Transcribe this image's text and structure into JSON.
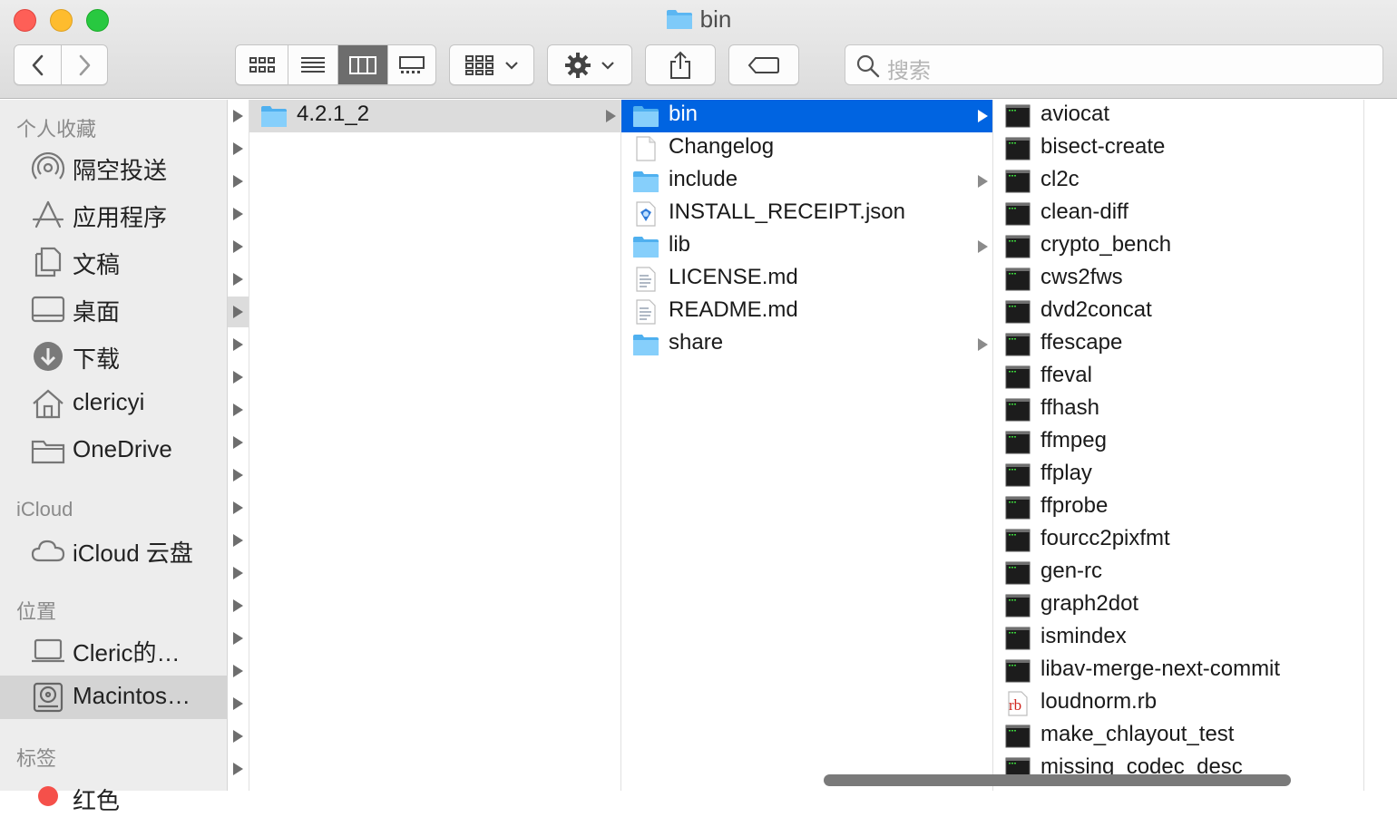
{
  "window": {
    "title": "bin"
  },
  "toolbar": {
    "back_icon": "chevron-left-icon",
    "forward_icon": "chevron-right-icon",
    "view_modes": [
      "icon-view",
      "list-view",
      "column-view",
      "gallery-view"
    ],
    "active_view": "column-view",
    "search_placeholder": "搜索"
  },
  "sidebar": {
    "sections": [
      {
        "header": "个人收藏",
        "items": [
          {
            "label": "隔空投送",
            "icon": "airdrop-icon"
          },
          {
            "label": "应用程序",
            "icon": "applications-icon"
          },
          {
            "label": "文稿",
            "icon": "documents-icon"
          },
          {
            "label": "桌面",
            "icon": "desktop-icon"
          },
          {
            "label": "下载",
            "icon": "downloads-icon"
          },
          {
            "label": "clericyi",
            "icon": "home-icon"
          },
          {
            "label": "OneDrive",
            "icon": "folder-icon"
          }
        ]
      },
      {
        "header": "iCloud",
        "items": [
          {
            "label": "iCloud 云盘",
            "icon": "cloud-icon"
          }
        ]
      },
      {
        "header": "位置",
        "items": [
          {
            "label": "Cleric的…",
            "icon": "laptop-icon"
          },
          {
            "label": "Macintos…",
            "icon": "hard-drive-icon",
            "selected": true
          }
        ]
      },
      {
        "header": "标签",
        "items": [
          {
            "label": "红色",
            "icon": "red-tag-icon"
          }
        ]
      }
    ]
  },
  "columns": {
    "col1": [
      {
        "name": "4.2.1_2",
        "icon": "folder-icon",
        "has_children": true,
        "selected": "inactive"
      }
    ],
    "col2": [
      {
        "name": "bin",
        "icon": "folder-icon",
        "has_children": true,
        "selected": "active"
      },
      {
        "name": "Changelog",
        "icon": "document-icon",
        "has_children": false
      },
      {
        "name": "include",
        "icon": "folder-icon",
        "has_children": true
      },
      {
        "name": "INSTALL_RECEIPT.json",
        "icon": "json-file-icon",
        "has_children": false
      },
      {
        "name": "lib",
        "icon": "folder-icon",
        "has_children": true
      },
      {
        "name": "LICENSE.md",
        "icon": "text-file-icon",
        "has_children": false
      },
      {
        "name": "README.md",
        "icon": "text-file-icon",
        "has_children": false
      },
      {
        "name": "share",
        "icon": "folder-icon",
        "has_children": true
      }
    ],
    "col3": [
      {
        "name": "aviocat",
        "icon": "terminal-exec-icon"
      },
      {
        "name": "bisect-create",
        "icon": "terminal-exec-icon"
      },
      {
        "name": "cl2c",
        "icon": "terminal-exec-icon"
      },
      {
        "name": "clean-diff",
        "icon": "terminal-exec-icon"
      },
      {
        "name": "crypto_bench",
        "icon": "terminal-exec-icon"
      },
      {
        "name": "cws2fws",
        "icon": "terminal-exec-icon"
      },
      {
        "name": "dvd2concat",
        "icon": "terminal-exec-icon"
      },
      {
        "name": "ffescape",
        "icon": "terminal-exec-icon"
      },
      {
        "name": "ffeval",
        "icon": "terminal-exec-icon"
      },
      {
        "name": "ffhash",
        "icon": "terminal-exec-icon"
      },
      {
        "name": "ffmpeg",
        "icon": "terminal-exec-icon"
      },
      {
        "name": "ffplay",
        "icon": "terminal-exec-icon"
      },
      {
        "name": "ffprobe",
        "icon": "terminal-exec-icon"
      },
      {
        "name": "fourcc2pixfmt",
        "icon": "terminal-exec-icon"
      },
      {
        "name": "gen-rc",
        "icon": "terminal-exec-icon"
      },
      {
        "name": "graph2dot",
        "icon": "terminal-exec-icon"
      },
      {
        "name": "ismindex",
        "icon": "terminal-exec-icon"
      },
      {
        "name": "libav-merge-next-commit",
        "icon": "terminal-exec-icon"
      },
      {
        "name": "loudnorm.rb",
        "icon": "ruby-file-icon",
        "badge": "rb"
      },
      {
        "name": "make_chlayout_test",
        "icon": "terminal-exec-icon"
      },
      {
        "name": "missing_codec_desc",
        "icon": "terminal-exec-icon"
      }
    ]
  }
}
